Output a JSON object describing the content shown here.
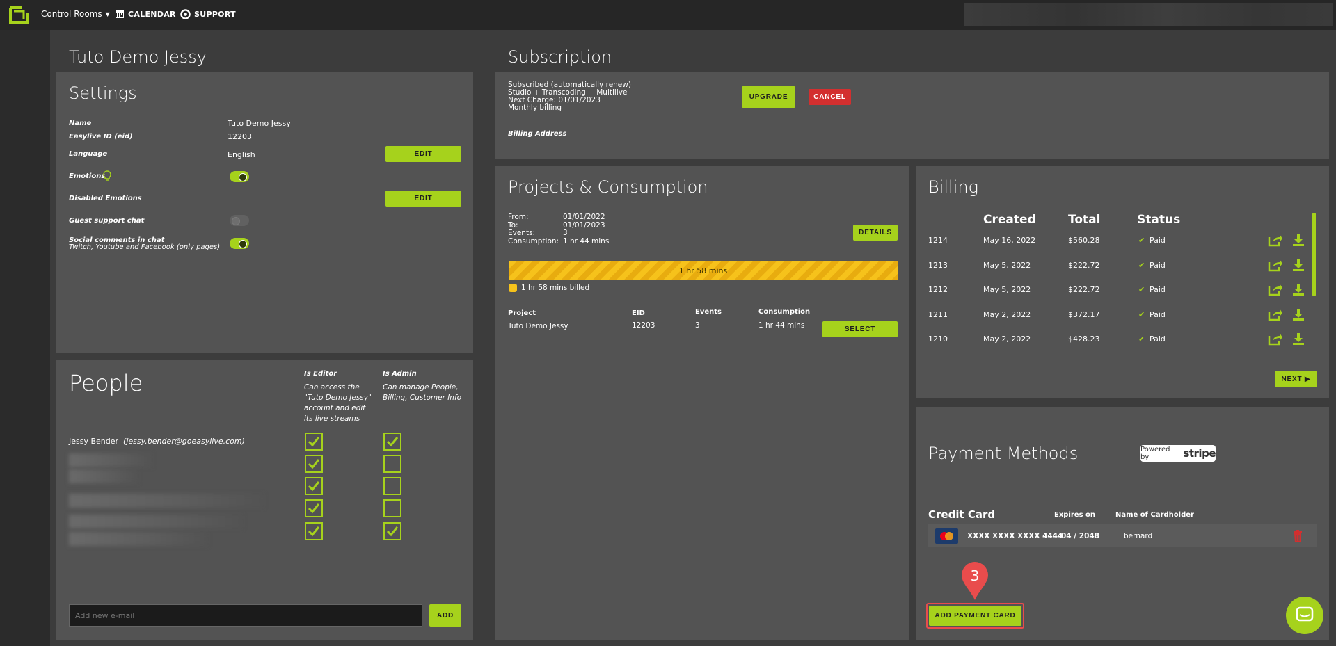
{
  "topbar": {
    "control_rooms": "Control Rooms",
    "calendar": "CALENDAR",
    "support": "SUPPORT"
  },
  "account_title": "Tuto Demo Jessy",
  "settings": {
    "title": "Settings",
    "name_label": "Name",
    "name_value": "Tuto Demo Jessy",
    "eid_label": "Easylive ID (eid)",
    "eid_value": "12203",
    "language_label": "Language",
    "language_value": "English",
    "edit_label": "EDIT",
    "emotions_label": "Emotions",
    "disabled_emotions_label": "Disabled Emotions",
    "edit2_label": "EDIT",
    "guest_support_label": "Guest support chat",
    "social_label": "Social comments in chat",
    "social_sub": "Twitch, Youtube and Facebook (only pages)",
    "toggles": {
      "emotions": true,
      "guest_support": false,
      "social": true
    }
  },
  "people": {
    "title": "People",
    "is_editor": "Is Editor",
    "is_admin": "Is Admin",
    "editor_desc": "Can access the \"Tuto Demo Jessy\" account and edit its live streams",
    "admin_desc": "Can manage People, Billing, Customer Info",
    "person_name": "Jessy Bender",
    "person_email": "(jessy.bender@goeasylive.com)",
    "rows": [
      {
        "editor": true,
        "admin": true
      },
      {
        "editor": true,
        "admin": false
      },
      {
        "editor": true,
        "admin": false
      },
      {
        "editor": true,
        "admin": false
      },
      {
        "editor": true,
        "admin": true
      }
    ],
    "email_placeholder": "Add new e-mail",
    "add_label": "ADD"
  },
  "subscription": {
    "title": "Subscription",
    "line1": "Subscribed (automatically renew)",
    "line2": "Studio + Transcoding + Multilive",
    "line3": "Next Charge: 01/01/2023",
    "line4": "Monthly billing",
    "billing_address_label": "Billing Address",
    "upgrade_label": "UPGRADE",
    "cancel_label": "CANCEL"
  },
  "projects": {
    "title": "Projects & Consumption",
    "from_label": "From:",
    "from_value": "01/01/2022",
    "to_label": "To:",
    "to_value": "01/01/2023",
    "events_label": "Events:",
    "events_value": "3",
    "consumption_label": "Consumption:",
    "consumption_value": "1 hr 44 mins",
    "details_label": "DETAILS",
    "progress_text": "1 hr 58 mins",
    "legend_text": "1 hr 58 mins billed",
    "colors": {
      "bar": "#f6c21b"
    },
    "table_headers": [
      "Project",
      "EID",
      "Events",
      "Consumption"
    ],
    "table_row": [
      "Tuto Demo Jessy",
      "12203",
      "3",
      "1 hr 44 mins"
    ],
    "select_label": "SELECT"
  },
  "billing": {
    "title": "Billing",
    "headers": [
      "Created",
      "Total",
      "Status"
    ],
    "rows": [
      {
        "id": "1214",
        "created": "May 16, 2022",
        "total": "$560.28",
        "status": "Paid"
      },
      {
        "id": "1213",
        "created": "May 5, 2022",
        "total": "$222.72",
        "status": "Paid"
      },
      {
        "id": "1212",
        "created": "May 5, 2022",
        "total": "$222.72",
        "status": "Paid"
      },
      {
        "id": "1211",
        "created": "May 2, 2022",
        "total": "$372.17",
        "status": "Paid"
      },
      {
        "id": "1210",
        "created": "May 2, 2022",
        "total": "$428.23",
        "status": "Paid"
      }
    ],
    "next_label": "NEXT"
  },
  "payment": {
    "title": "Payment Methods",
    "powered_by": "Powered by",
    "stripe": "stripe",
    "credit_card_header": "Credit Card",
    "expires_header": "Expires on",
    "cardholder_header": "Name of Cardholder",
    "card_number": "XXXX XXXX XXXX 4444",
    "card_expiry": "04 / 2048",
    "cardholder": "bernard",
    "add_card_label": "ADD PAYMENT CARD",
    "callout_number": "3"
  },
  "accent": "#a6d21c"
}
